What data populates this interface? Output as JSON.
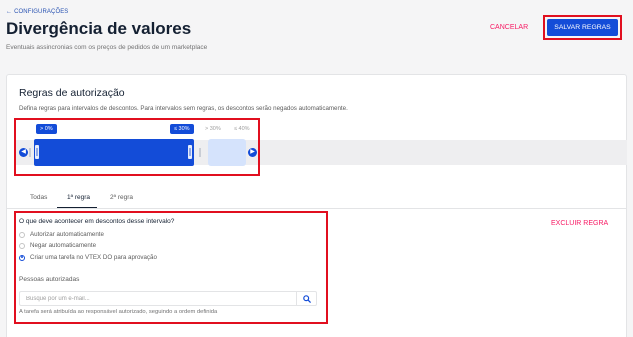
{
  "header": {
    "back_label": "CONFIGURAÇÕES",
    "title": "Divergência de valores",
    "subtitle": "Eventuais assincronias com os preços de pedidos de um marketplace",
    "cancel_label": "CANCELAR",
    "save_label": "SALVAR REGRAS"
  },
  "authorization": {
    "title": "Regras de autorização",
    "description": "Defina regras para intervalos de descontos. Para intervalos sem regras, os descontos serão negados automaticamente.",
    "slider": {
      "min_label": "> 0%",
      "max_label": "≤ 30%",
      "next_label_1": "> 30%",
      "next_label_2": "≤ 40%"
    }
  },
  "tabs": [
    {
      "label": "Todas"
    },
    {
      "label": "1ª regra"
    },
    {
      "label": "2ª regra"
    }
  ],
  "active_tab": "1ª regra",
  "rule": {
    "question": "O que deve acontecer em descontos desse intervalo?",
    "options": [
      {
        "label": "Autorizar automaticamente",
        "selected": false
      },
      {
        "label": "Negar automaticamente",
        "selected": false
      },
      {
        "label": "Criar uma tarefa no VTEX DO para aprovação",
        "selected": true
      }
    ],
    "people_label": "Pessoas autorizadas",
    "search_placeholder": "Busque por um e-mail...",
    "helper": "A tarefa será atribuída ao responsável autorizado, seguindo a ordem definida",
    "delete_label": "EXCLUIR REGRA"
  },
  "icons": {
    "back": "arrow-left-icon",
    "prev": "chevron-left-icon",
    "next": "chevron-right-icon",
    "search": "search-icon"
  },
  "colors": {
    "primary": "#134cd8",
    "danger": "#f71963",
    "highlight": "#e10f1f"
  }
}
